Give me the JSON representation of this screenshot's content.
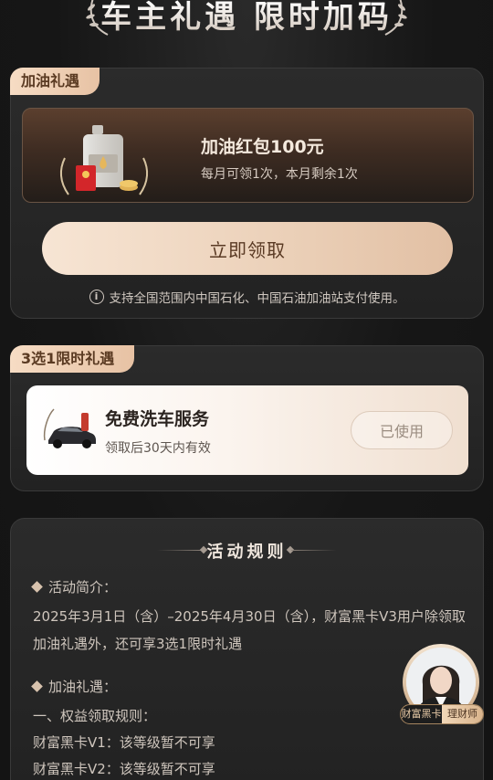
{
  "header": {
    "title": "车主礼遇 限时加码"
  },
  "fuel": {
    "tag": "加油礼遇",
    "coupon_title": "加油红包100元",
    "coupon_sub": "每月可领1次，本月剩余1次",
    "claim_label": "立即领取",
    "note": "支持全国范围内中国石化、中国石油加油站支付使用。",
    "info_glyph": "i"
  },
  "pick": {
    "tag": "3选1限时礼遇",
    "item_title": "免费洗车服务",
    "item_sub": "领取后30天内有效",
    "used_label": "已使用"
  },
  "rules": {
    "title": "活动规则",
    "intro_title": "活动简介：",
    "intro_text": "2025年3月1日（含）–2025年4月30日（含），财富黑卡V3用户除领取加油礼遇外，还可享3选1限时礼遇",
    "fuel_title": "加油礼遇：",
    "line1": "一、权益领取规则：",
    "line2": "财富黑卡V1：该等级暂不可享",
    "line3": "财富黑卡V2：该等级暂不可享"
  },
  "advisor": {
    "left_label": "财富黑卡",
    "right_label": "理财师"
  },
  "colors": {
    "accent": "#e7c2a4",
    "bg": "#161616"
  }
}
